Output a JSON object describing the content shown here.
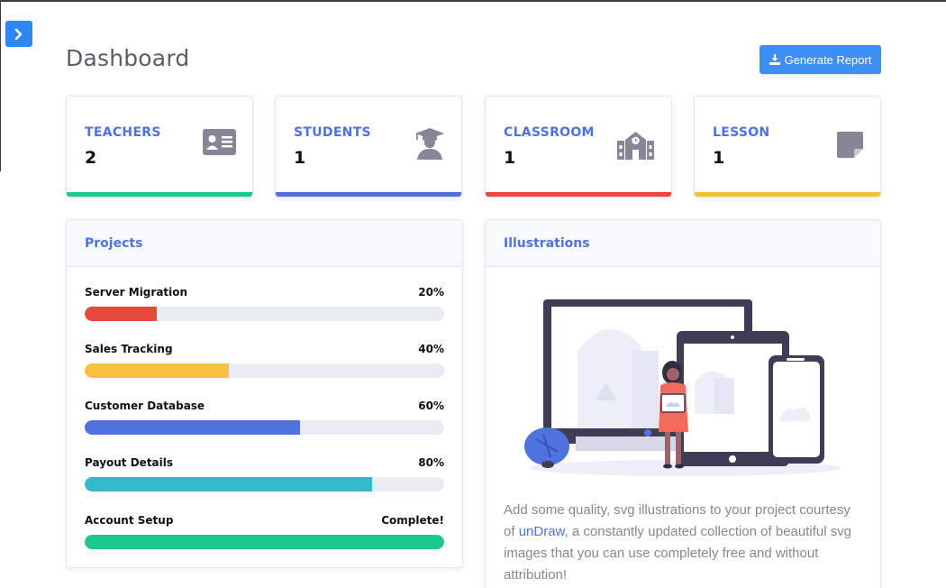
{
  "page": {
    "title": "Dashboard"
  },
  "toolbar": {
    "generate_label": "Generate Report"
  },
  "stats": [
    {
      "label": "TEACHERS",
      "value": "2",
      "icon": "id-card-icon",
      "color": "#1cc88a"
    },
    {
      "label": "STUDENTS",
      "value": "1",
      "icon": "graduate-icon",
      "color": "#4e73df"
    },
    {
      "label": "CLASSROOM",
      "value": "1",
      "icon": "school-icon",
      "color": "#e74a3b"
    },
    {
      "label": "LESSON",
      "value": "1",
      "icon": "sticky-note-icon",
      "color": "#f6c23e"
    }
  ],
  "projects": {
    "title": "Projects",
    "items": [
      {
        "name": "Server Migration",
        "status": "20%",
        "progress": 0.2,
        "color": "#e74a3b"
      },
      {
        "name": "Sales Tracking",
        "status": "40%",
        "progress": 0.4,
        "color": "#f6c23e"
      },
      {
        "name": "Customer Database",
        "status": "60%",
        "progress": 0.6,
        "color": "#4e73df"
      },
      {
        "name": "Payout Details",
        "status": "80%",
        "progress": 0.8,
        "color": "#36b9cc"
      },
      {
        "name": "Account Setup",
        "status": "Complete!",
        "progress": 1.0,
        "color": "#1cc88a"
      }
    ]
  },
  "illustrations": {
    "title": "Illustrations",
    "text_before": "Add some quality, svg illustrations to your project courtesy of ",
    "link": "unDraw",
    "text_after": ", a constantly updated collection of beautiful svg images that you can use completely free and without attribution!"
  }
}
